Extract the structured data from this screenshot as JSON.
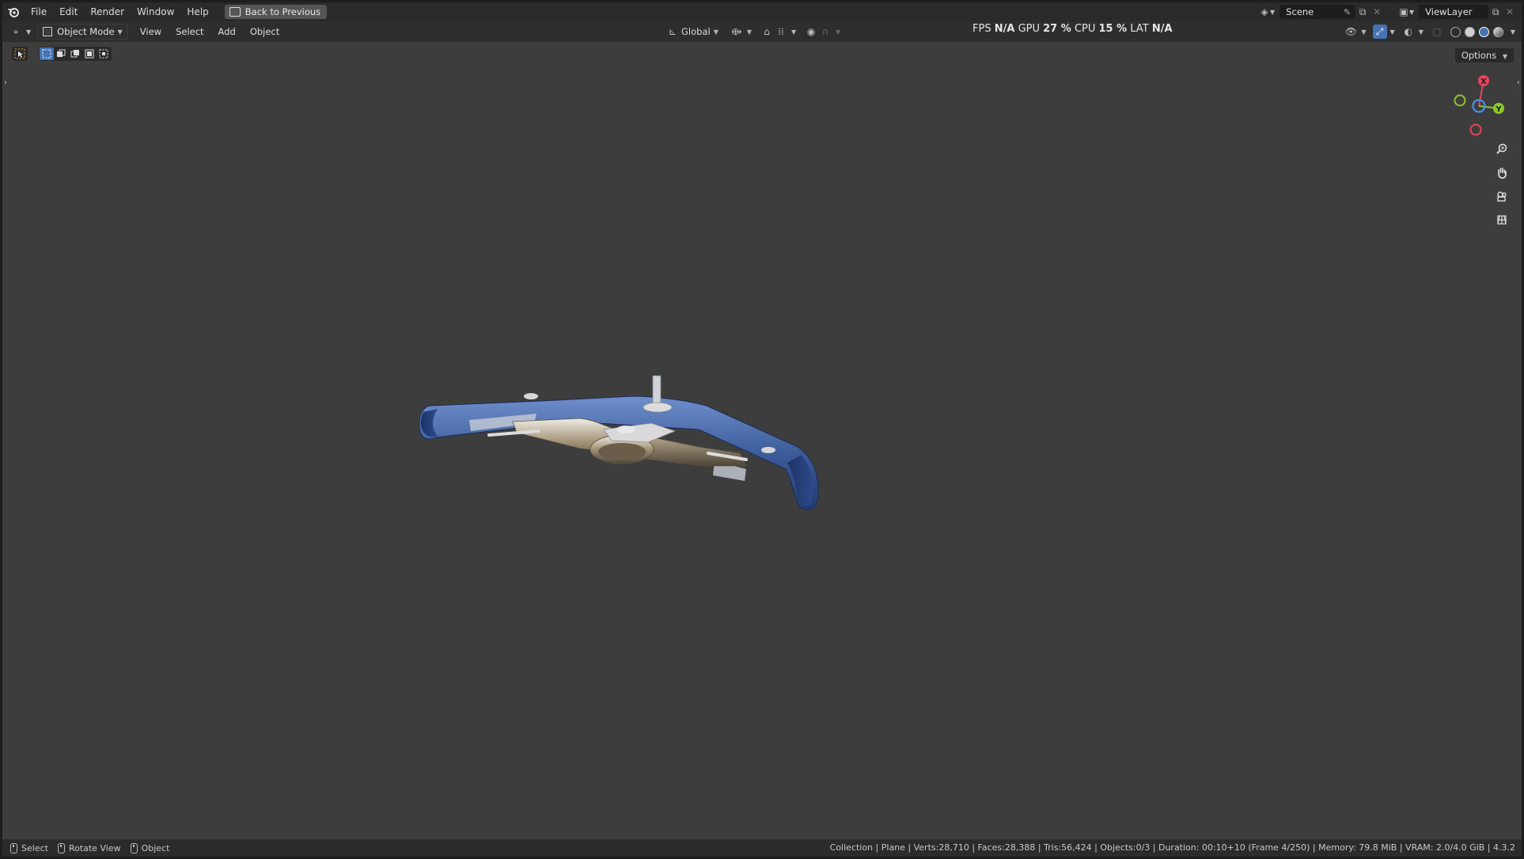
{
  "topbar": {
    "menu": [
      "File",
      "Edit",
      "Render",
      "Window",
      "Help"
    ],
    "back_label": "Back to Previous",
    "scene_label": "Scene",
    "viewlayer_label": "ViewLayer"
  },
  "header": {
    "mode_label": "Object Mode",
    "menu": [
      "View",
      "Select",
      "Add",
      "Object"
    ],
    "orientation_label": "Global"
  },
  "stats": {
    "fps_label": "FPS",
    "fps_value": "N/A",
    "gpu_label": "GPU",
    "gpu_value": "27 %",
    "cpu_label": "CPU",
    "cpu_value": "15 %",
    "lat_label": "LAT",
    "lat_value": "N/A"
  },
  "viewport": {
    "options_label": "Options",
    "axis_x": "X",
    "axis_y": "Y",
    "accent_color": "#4772b3",
    "object_color": "#3f5f9c"
  },
  "statusbar": {
    "left": [
      "Select",
      "Rotate View",
      "Object"
    ],
    "right": "Collection | Plane | Verts:28,710 | Faces:28,388 | Tris:56,424 | Objects:0/3 | Duration: 00:10+10 (Frame 4/250) | Memory: 79.8 MiB | VRAM: 2.0/4.0 GiB | 4.3.2"
  }
}
